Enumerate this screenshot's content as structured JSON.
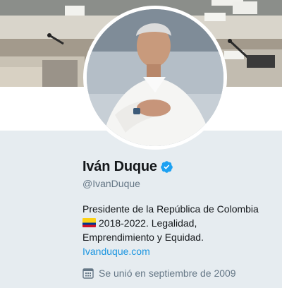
{
  "profile": {
    "name": "Iván Duque",
    "handle": "@IvanDuque",
    "bio_line1": "Presidente de la República de Colombia",
    "bio_line2": "2018-2022. Legalidad,",
    "bio_line3": "Emprendimiento y Equidad.",
    "website": "Ivanduque.com",
    "joined": "Se unió en septiembre de 2009",
    "verified_icon": "verified-badge-icon",
    "flag_icon": "colombia-flag-icon",
    "calendar_icon": "calendar-icon"
  },
  "colors": {
    "link": "#1b95e0",
    "verified": "#1da1f2",
    "secondary_text": "#657786",
    "page_background": "#e6ecf0"
  }
}
